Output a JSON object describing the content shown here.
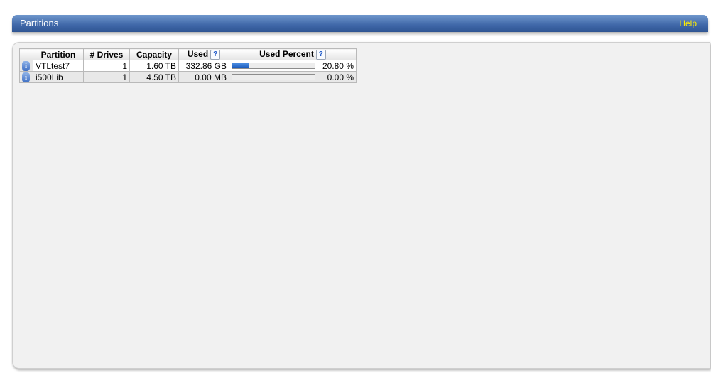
{
  "header": {
    "title": "Partitions",
    "help_label": "Help"
  },
  "table": {
    "columns": [
      "",
      "Partition",
      "# Drives",
      "Capacity",
      "Used",
      "Used Percent"
    ],
    "rows": [
      {
        "partition": "VTLtest7",
        "drives": "1",
        "capacity": "1.60 TB",
        "used": "332.86 GB",
        "used_percent": "20.80 %",
        "used_fraction": 0.208
      },
      {
        "partition": "i500Lib",
        "drives": "1",
        "capacity": "4.50 TB",
        "used": "0.00 MB",
        "used_percent": "0.00 %",
        "used_fraction": 0.0
      }
    ]
  },
  "icons": {
    "info": "info-icon",
    "help_qmark": "question-mark-icon"
  },
  "colors": {
    "header_bar": "#3f67a8",
    "help_link": "#ffee00",
    "progress_fill": "#1b5bbd"
  }
}
